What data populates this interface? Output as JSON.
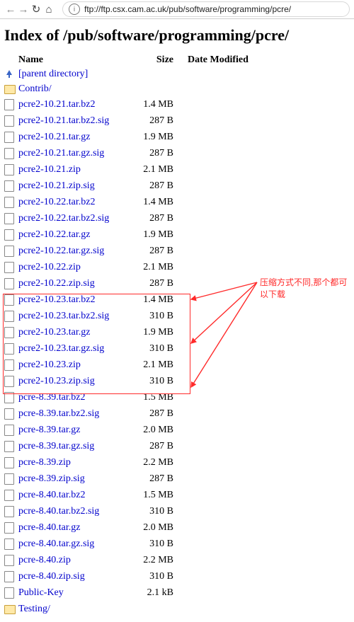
{
  "browser": {
    "url": "ftp://ftp.csx.cam.ac.uk/pub/software/programming/pcre/"
  },
  "page": {
    "heading": "Index of /pub/software/programming/pcre/",
    "columns": {
      "name": "Name",
      "size": "Size",
      "date": "Date Modified"
    },
    "parent_label": "[parent directory]",
    "entries": [
      {
        "name": "Contrib/",
        "size": "",
        "type": "folder"
      },
      {
        "name": "pcre2-10.21.tar.bz2",
        "size": "1.4 MB",
        "type": "file"
      },
      {
        "name": "pcre2-10.21.tar.bz2.sig",
        "size": "287 B",
        "type": "file"
      },
      {
        "name": "pcre2-10.21.tar.gz",
        "size": "1.9 MB",
        "type": "file"
      },
      {
        "name": "pcre2-10.21.tar.gz.sig",
        "size": "287 B",
        "type": "file"
      },
      {
        "name": "pcre2-10.21.zip",
        "size": "2.1 MB",
        "type": "file"
      },
      {
        "name": "pcre2-10.21.zip.sig",
        "size": "287 B",
        "type": "file"
      },
      {
        "name": "pcre2-10.22.tar.bz2",
        "size": "1.4 MB",
        "type": "file"
      },
      {
        "name": "pcre2-10.22.tar.bz2.sig",
        "size": "287 B",
        "type": "file"
      },
      {
        "name": "pcre2-10.22.tar.gz",
        "size": "1.9 MB",
        "type": "file"
      },
      {
        "name": "pcre2-10.22.tar.gz.sig",
        "size": "287 B",
        "type": "file"
      },
      {
        "name": "pcre2-10.22.zip",
        "size": "2.1 MB",
        "type": "file"
      },
      {
        "name": "pcre2-10.22.zip.sig",
        "size": "287 B",
        "type": "file"
      },
      {
        "name": "pcre2-10.23.tar.bz2",
        "size": "1.4 MB",
        "type": "file",
        "hl": true
      },
      {
        "name": "pcre2-10.23.tar.bz2.sig",
        "size": "310 B",
        "type": "file",
        "hl": true
      },
      {
        "name": "pcre2-10.23.tar.gz",
        "size": "1.9 MB",
        "type": "file",
        "hl": true
      },
      {
        "name": "pcre2-10.23.tar.gz.sig",
        "size": "310 B",
        "type": "file",
        "hl": true
      },
      {
        "name": "pcre2-10.23.zip",
        "size": "2.1 MB",
        "type": "file",
        "hl": true
      },
      {
        "name": "pcre2-10.23.zip.sig",
        "size": "310 B",
        "type": "file",
        "hl": true
      },
      {
        "name": "pcre-8.39.tar.bz2",
        "size": "1.5 MB",
        "type": "file"
      },
      {
        "name": "pcre-8.39.tar.bz2.sig",
        "size": "287 B",
        "type": "file"
      },
      {
        "name": "pcre-8.39.tar.gz",
        "size": "2.0 MB",
        "type": "file"
      },
      {
        "name": "pcre-8.39.tar.gz.sig",
        "size": "287 B",
        "type": "file"
      },
      {
        "name": "pcre-8.39.zip",
        "size": "2.2 MB",
        "type": "file"
      },
      {
        "name": "pcre-8.39.zip.sig",
        "size": "287 B",
        "type": "file"
      },
      {
        "name": "pcre-8.40.tar.bz2",
        "size": "1.5 MB",
        "type": "file"
      },
      {
        "name": "pcre-8.40.tar.bz2.sig",
        "size": "310 B",
        "type": "file"
      },
      {
        "name": "pcre-8.40.tar.gz",
        "size": "2.0 MB",
        "type": "file"
      },
      {
        "name": "pcre-8.40.tar.gz.sig",
        "size": "310 B",
        "type": "file"
      },
      {
        "name": "pcre-8.40.zip",
        "size": "2.2 MB",
        "type": "file"
      },
      {
        "name": "pcre-8.40.zip.sig",
        "size": "310 B",
        "type": "file"
      },
      {
        "name": "Public-Key",
        "size": "2.1 kB",
        "type": "file"
      },
      {
        "name": "Testing/",
        "size": "",
        "type": "folder"
      }
    ]
  },
  "annotation": {
    "text": "压缩方式不同,那个都可以下载"
  }
}
